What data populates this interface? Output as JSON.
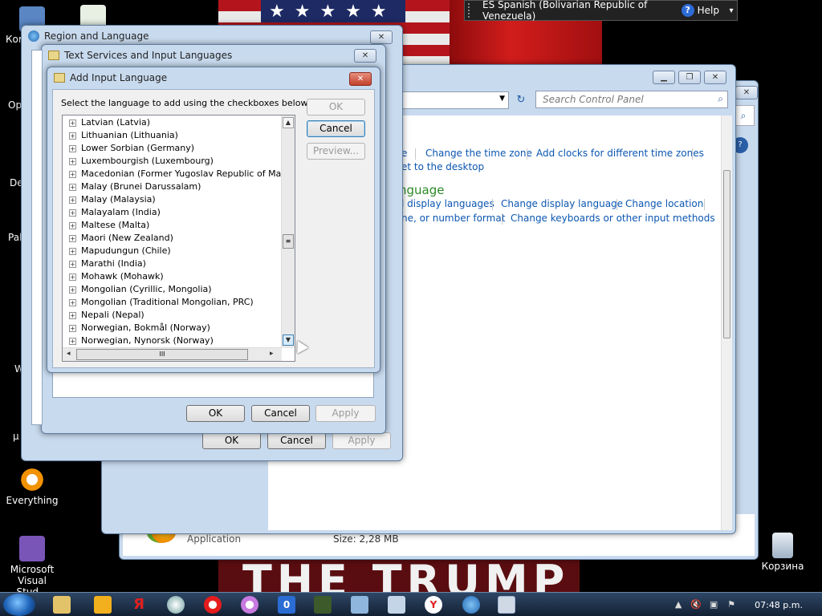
{
  "language_bar": {
    "current": "ES Spanish (Bolivarian Republic of Venezuela)",
    "help": "Help"
  },
  "desktop": {
    "partial_labels": [
      "Ком",
      "Op",
      "De",
      "Pal",
      "W",
      "µ"
    ],
    "everything": "Everything",
    "visual_studio": "Microsoft Visual Stud...",
    "recycle_bin": "Корзина"
  },
  "control_panel": {
    "search_placeholder": "Search Control Panel",
    "links_row1": [
      "e",
      "Change the time zone",
      "Add clocks for different time zones"
    ],
    "link_row2": "et to the desktop",
    "heading": "nguage",
    "links_row3": [
      "l display languages",
      "Change display language",
      "Change location"
    ],
    "links_row4": [
      "ne, or number format",
      "Change keyboards or other input methods"
    ]
  },
  "lower_window": {
    "app_label": "Application",
    "size_label": "Size: 2,28 MB"
  },
  "region_window": {
    "title": "Region and Language",
    "ok": "OK",
    "cancel": "Cancel",
    "apply": "Apply"
  },
  "text_services_window": {
    "title": "Text Services and Input Languages",
    "ok": "OK",
    "cancel": "Cancel",
    "apply": "Apply"
  },
  "add_input_dialog": {
    "title": "Add Input Language",
    "instruction": "Select the language to add using the checkboxes below.",
    "ok": "OK",
    "cancel": "Cancel",
    "preview": "Preview...",
    "languages": [
      "Latvian (Latvia)",
      "Lithuanian (Lithuania)",
      "Lower Sorbian (Germany)",
      "Luxembourgish (Luxembourg)",
      "Macedonian (Former Yugoslav Republic of Macedon",
      "Malay (Brunei Darussalam)",
      "Malay (Malaysia)",
      "Malayalam (India)",
      "Maltese (Malta)",
      "Maori (New Zealand)",
      "Mapudungun (Chile)",
      "Marathi (India)",
      "Mohawk (Mohawk)",
      "Mongolian (Cyrillic, Mongolia)",
      "Mongolian (Traditional Mongolian, PRC)",
      "Nepali (Nepal)",
      "Norwegian, Bokmål (Norway)",
      "Norwegian, Nynorsk (Norway)"
    ]
  },
  "taskbar": {
    "clock": "07:48 p.m."
  }
}
